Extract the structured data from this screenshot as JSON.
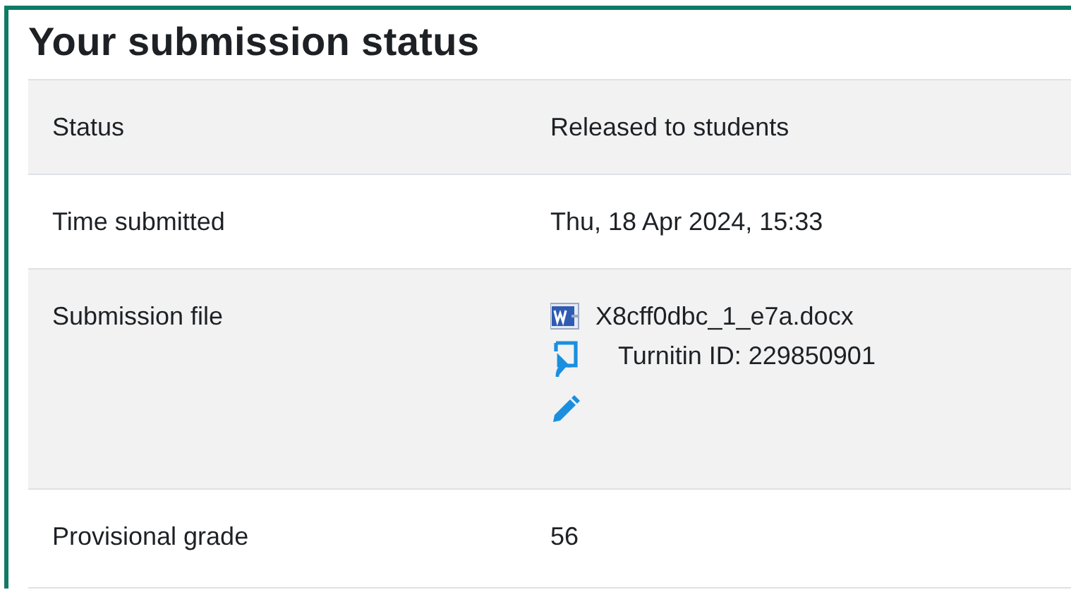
{
  "heading": "Your submission status",
  "rows": [
    {
      "label": "Status",
      "kind": "text",
      "value": "Released to students"
    },
    {
      "label": "Time submitted",
      "kind": "text",
      "value": "Thu, 18 Apr 2024, 15:33"
    },
    {
      "label": "Submission file",
      "kind": "files",
      "file_name": "X8cff0dbc_1_e7a.docx",
      "turnitin": "Turnitin ID: 229850901"
    },
    {
      "label": "Provisional grade",
      "kind": "text",
      "value": "56"
    }
  ]
}
